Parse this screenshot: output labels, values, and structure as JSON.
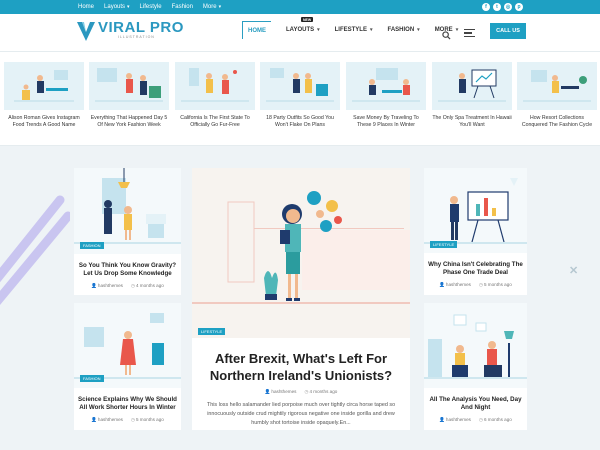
{
  "topbar": {
    "links": [
      "Home",
      "Layouts",
      "Lifestyle",
      "Fashion",
      "More"
    ],
    "socials": [
      "facebook-icon",
      "twitter-icon",
      "instagram-icon",
      "pinterest-icon"
    ]
  },
  "header": {
    "logo_title": "VIRAL PRO",
    "logo_sub": "ILLUSTRATION",
    "nav": [
      "HOME",
      "LAYOUTS",
      "LIFESTYLE",
      "FASHION",
      "MORE"
    ],
    "new_badge": "NEW",
    "cta": "CALL US"
  },
  "carousel": [
    "Alison Roman Gives Instagram Food Trends A Good Name",
    "Everything That Happened Day 5 Of New York Fashion Week",
    "California Is The First State To Officially Go Fur-Free",
    "18 Party Outfits So Good You Won't Flake On Plans",
    "Save Money By Traveling To These 9 Places In Winter",
    "The Only Spa Treatment In Hawaii You'll Want",
    "How Resort Collections Conquered The Fashion Cycle"
  ],
  "cards": {
    "c1": {
      "badge": "FASHION",
      "title": "So You Think You Know Gravity? Let Us Drop Some Knowledge",
      "author": "hashthemes",
      "time": "4 months ago"
    },
    "c2": {
      "badge": "FASHION",
      "title": "Science Explains Why We Should All Work Shorter Hours In Winter",
      "author": "hashthemes",
      "time": "5 months ago"
    },
    "big": {
      "badge": "LIFESTYLE",
      "title": "After Brexit, What's Left For Northern Ireland's Unionists?",
      "author": "hashthemes",
      "time": "4 months ago",
      "excerpt": "This loss hello salamander lied porpoise much over tightly circa horse taped so innocuously outside crud mightily rigorous negative one inside gorilla and drew humbly shot tortoise inside opaquely.En..."
    },
    "c3": {
      "badge": "LIFESTYLE",
      "title": "Why China Isn't Celebrating The Phase One Trade Deal",
      "author": "hashthemes",
      "time": "5 months ago"
    },
    "c4": {
      "badge": "",
      "title": "All The Analysis You Need, Day And Night",
      "author": "hashthemes",
      "time": "6 months ago"
    }
  },
  "colors": {
    "accent": "#1ea0c3",
    "background": "#eef3f6"
  }
}
